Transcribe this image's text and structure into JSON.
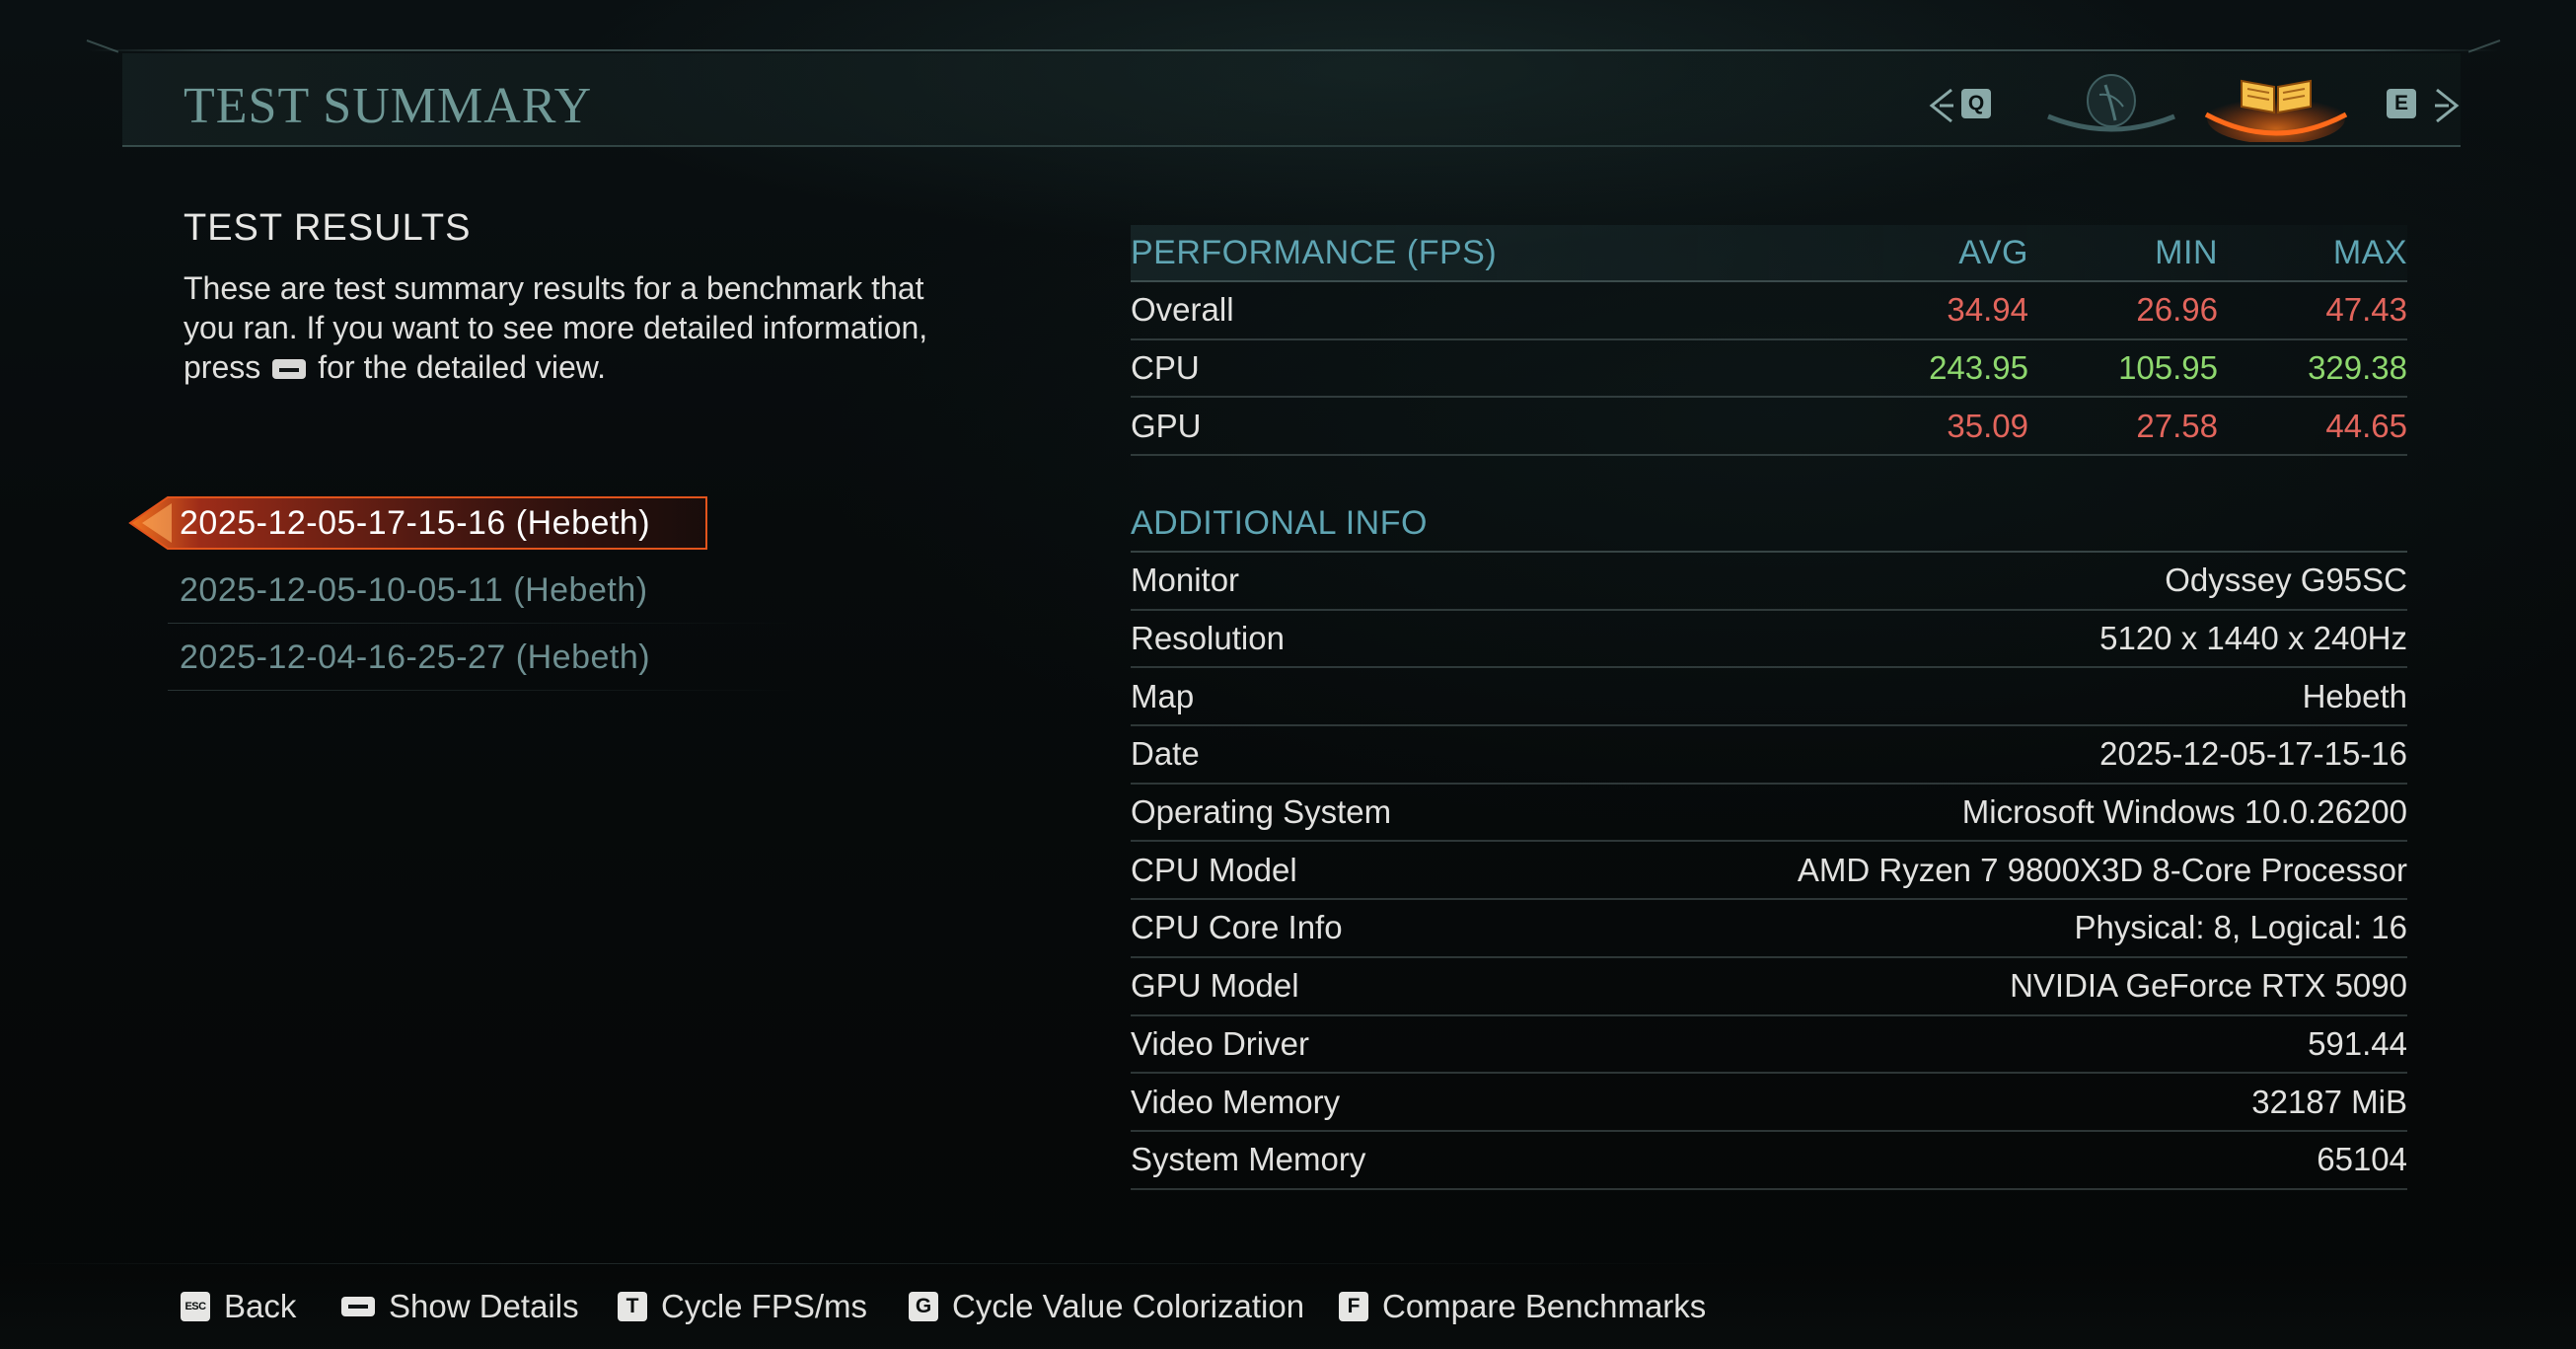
{
  "header": {
    "title": "TEST SUMMARY",
    "nav_prev_key": "Q",
    "nav_next_key": "E",
    "tabs": [
      {
        "icon": "character-portrait-icon",
        "active": false
      },
      {
        "icon": "open-book-icon",
        "active": true
      }
    ]
  },
  "left": {
    "heading": "TEST RESULTS",
    "description_part1": "These are test summary results for a benchmark that you ran. If you want to see more detailed information, press",
    "description_part2": "for the detailed view.",
    "runs": [
      {
        "label": "2025-12-05-17-15-16 (Hebeth)",
        "selected": true
      },
      {
        "label": "2025-12-05-10-05-11 (Hebeth)",
        "selected": false
      },
      {
        "label": "2025-12-04-16-25-27 (Hebeth)",
        "selected": false
      }
    ]
  },
  "performance": {
    "heading": "PERFORMANCE (FPS)",
    "columns": [
      "AVG",
      "MIN",
      "MAX"
    ],
    "rows": [
      {
        "name": "Overall",
        "avg": "34.94",
        "min": "26.96",
        "max": "47.43",
        "color": "#e2655c"
      },
      {
        "name": "CPU",
        "avg": "243.95",
        "min": "105.95",
        "max": "329.38",
        "color": "#8ed86e"
      },
      {
        "name": "GPU",
        "avg": "35.09",
        "min": "27.58",
        "max": "44.65",
        "color": "#e2655c"
      }
    ]
  },
  "additional": {
    "heading": "ADDITIONAL INFO",
    "rows": [
      {
        "name": "Monitor",
        "value": "Odyssey G95SC"
      },
      {
        "name": "Resolution",
        "value": "5120 x 1440 x 240Hz"
      },
      {
        "name": "Map",
        "value": "Hebeth"
      },
      {
        "name": "Date",
        "value": "2025-12-05-17-15-16"
      },
      {
        "name": "Operating System",
        "value": "Microsoft Windows 10.0.26200"
      },
      {
        "name": "CPU Model",
        "value": "AMD Ryzen 7 9800X3D 8-Core Processor"
      },
      {
        "name": "CPU Core Info",
        "value": "Physical: 8, Logical: 16"
      },
      {
        "name": "GPU Model",
        "value": "NVIDIA GeForce RTX 5090"
      },
      {
        "name": "Video Driver",
        "value": "591.44"
      },
      {
        "name": "Video Memory",
        "value": "32187 MiB"
      },
      {
        "name": "System Memory",
        "value": "65104"
      }
    ]
  },
  "footer": {
    "hints": [
      {
        "key": "ESC",
        "label": "Back"
      },
      {
        "key": "",
        "label": "Show Details"
      },
      {
        "key": "T",
        "label": "Cycle FPS/ms"
      },
      {
        "key": "G",
        "label": "Cycle Value Colorization"
      },
      {
        "key": "F",
        "label": "Compare Benchmarks"
      }
    ]
  },
  "colors": {
    "accent_teal": "#5fa5b3",
    "title_teal": "#6f9896",
    "value_red": "#e2655c",
    "value_green": "#8ed86e",
    "selection_orange": "#e2541c"
  }
}
